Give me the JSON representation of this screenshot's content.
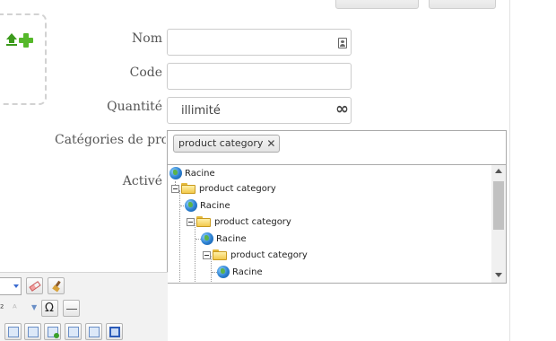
{
  "header": {
    "primary_button": "",
    "secondary_button": ""
  },
  "form": {
    "name_label": "Nom",
    "code_label": "Code",
    "quantity_label": "Quantité",
    "quantity_value": "illimité",
    "categories_label": "Catégories de produ",
    "active_label": "Activé",
    "name_value": "",
    "code_value": ""
  },
  "categories": {
    "selected_tag": "product category",
    "tree": [
      {
        "label": "Racine",
        "type": "globe",
        "depth": 0
      },
      {
        "label": "product category",
        "type": "folder",
        "depth": 1,
        "expanded": true
      },
      {
        "label": "Racine",
        "type": "globe",
        "depth": 1
      },
      {
        "label": "product category",
        "type": "folder",
        "depth": 2,
        "expanded": true
      },
      {
        "label": "Racine",
        "type": "globe",
        "depth": 2
      },
      {
        "label": "product category",
        "type": "folder",
        "depth": 3,
        "expanded": true
      },
      {
        "label": "Racine",
        "type": "globe",
        "depth": 3
      }
    ]
  },
  "icons": {
    "dropzone": [
      "upload-icon",
      "add-icon"
    ],
    "quantity": "infinity-icon",
    "name_field": "contact-card-icon",
    "toolbar": [
      "eraser-icon",
      "brush-icon",
      "special-char-icon",
      "horizontal-rule-icon",
      "table-icon"
    ]
  },
  "toolbar": {
    "omega": "Ω"
  },
  "colors": {
    "accent_green": "#55b82a",
    "folder_yellow": "#f2c94c",
    "border": "#aaaaaa"
  }
}
